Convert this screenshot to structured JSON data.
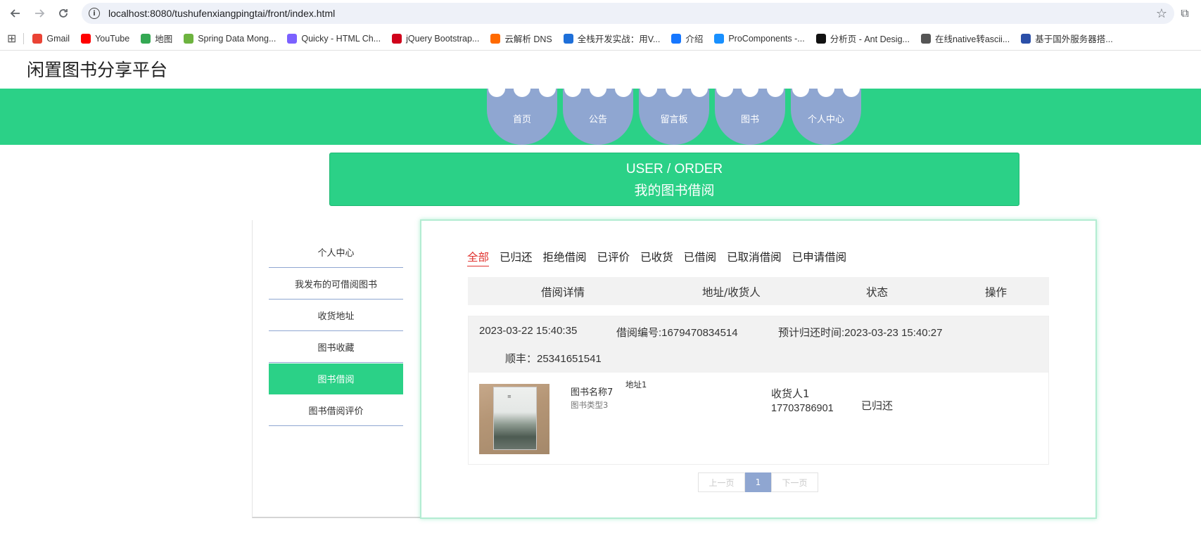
{
  "browser": {
    "url": "localhost:8080/tushufenxiangpingtai/front/index.html",
    "bookmarks": [
      {
        "label": "Gmail",
        "color": "#ea4335",
        "icon": "gmail-icon"
      },
      {
        "label": "YouTube",
        "color": "#ff0000",
        "icon": "youtube-icon"
      },
      {
        "label": "地图",
        "color": "#34a853",
        "icon": "maps-icon"
      },
      {
        "label": "Spring Data Mong...",
        "color": "#6db33f",
        "icon": "spring-icon"
      },
      {
        "label": "Quicky - HTML Ch...",
        "color": "#7b61ff",
        "icon": "quicky-icon"
      },
      {
        "label": "jQuery Bootstrap...",
        "color": "#d0021b",
        "icon": "jquery-icon"
      },
      {
        "label": "云解析 DNS",
        "color": "#ff6a00",
        "icon": "aliyun-icon"
      },
      {
        "label": "全栈开发实战：用V...",
        "color": "#1e6fd9",
        "icon": "m-icon"
      },
      {
        "label": "介绍",
        "color": "#1677ff",
        "icon": "globe-icon"
      },
      {
        "label": "ProComponents -...",
        "color": "#1890ff",
        "icon": "procomponents-icon"
      },
      {
        "label": "分析页 - Ant Desig...",
        "color": "#111111",
        "icon": "pro-icon"
      },
      {
        "label": "在线native转ascii...",
        "color": "#555555",
        "icon": "web-icon"
      },
      {
        "label": "基于国外服务器搭...",
        "color": "#2b4fa8",
        "icon": "server-icon"
      }
    ]
  },
  "site": {
    "title": "闲置图书分享平台",
    "nav": [
      "首页",
      "公告",
      "留言板",
      "图书",
      "个人中心"
    ]
  },
  "page_header": {
    "en": "USER / ORDER",
    "cn": "我的图书借阅"
  },
  "sidebar": {
    "items": [
      {
        "label": "个人中心",
        "active": false
      },
      {
        "label": "我发布的可借阅图书",
        "active": false
      },
      {
        "label": "收货地址",
        "active": false
      },
      {
        "label": "图书收藏",
        "active": false
      },
      {
        "label": "图书借阅",
        "active": true
      },
      {
        "label": "图书借阅评价",
        "active": false
      }
    ]
  },
  "tabs": [
    "全部",
    "已归还",
    "拒绝借阅",
    "已评价",
    "已收货",
    "已借阅",
    "已取消借阅",
    "已申请借阅"
  ],
  "table_headers": [
    "借阅详情",
    "地址/收货人",
    "状态",
    "操作"
  ],
  "order": {
    "date": "2023-03-22 15:40:35",
    "number": "借阅编号:1679470834514",
    "return_time": "预计归还时间:2023-03-23 15:40:27",
    "courier": "顺丰：25341651541",
    "book_name": "图书名称7",
    "book_type": "图书类型3",
    "address": "地址1",
    "receiver": "收货人1",
    "phone": "17703786901",
    "status": "已归还"
  },
  "pager": {
    "prev": "上一页",
    "current": "1",
    "next": "下一页"
  }
}
